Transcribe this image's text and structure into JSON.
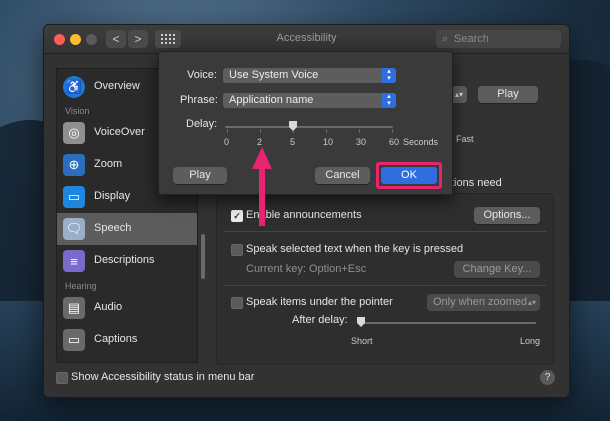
{
  "window": {
    "title": "Accessibility",
    "search_placeholder": "Search",
    "nav_back": "<",
    "nav_forward": ">",
    "grid_icon": "grid-icon"
  },
  "sidebar": {
    "items": [
      {
        "label": "Overview",
        "icon": "accessibility-icon",
        "color": "#1e78d6"
      },
      {
        "section": "Vision"
      },
      {
        "label": "VoiceOver",
        "icon": "voiceover-icon",
        "color": "#8f8f8f"
      },
      {
        "label": "Zoom",
        "icon": "zoom-icon",
        "color": "#2b6ec0"
      },
      {
        "label": "Display",
        "icon": "display-icon",
        "color": "#1f86e0"
      },
      {
        "label": "Speech",
        "icon": "speech-icon",
        "color": "#9ab0c8",
        "selected": true
      },
      {
        "label": "Descriptions",
        "icon": "descriptions-icon",
        "color": "#7a6acc"
      },
      {
        "section": "Hearing"
      },
      {
        "label": "Audio",
        "icon": "audio-icon",
        "color": "#6a6a6a"
      },
      {
        "label": "Captions",
        "icon": "captions-icon",
        "color": "#6a6a6a"
      }
    ]
  },
  "main": {
    "play_button": "Play",
    "speaking_rate_fast": "Fast",
    "announcements_tail": "tions need",
    "enable_announcements": "Enable announcements",
    "options_button": "Options...",
    "speak_selected": "Speak selected text when the key is pressed",
    "current_key": "Current key: Option+Esc",
    "change_key_button": "Change Key...",
    "speak_pointer": "Speak items under the pointer",
    "pointer_popup": "Only when zoomed",
    "after_delay": "After delay:",
    "short": "Short",
    "long": "Long"
  },
  "footer": {
    "show_status": "Show Accessibility status in menu bar",
    "help": "?"
  },
  "sheet": {
    "voice_label": "Voice:",
    "voice_value": "Use System Voice",
    "phrase_label": "Phrase:",
    "phrase_value": "Application name",
    "delay_label": "Delay:",
    "delay_ticks": [
      "0",
      "2",
      "5",
      "10",
      "30",
      "60"
    ],
    "delay_unit": "Seconds",
    "delay_selected": "5",
    "play_button": "Play",
    "cancel_button": "Cancel",
    "ok_button": "OK"
  },
  "annotation": {
    "color": "#e8236f"
  }
}
